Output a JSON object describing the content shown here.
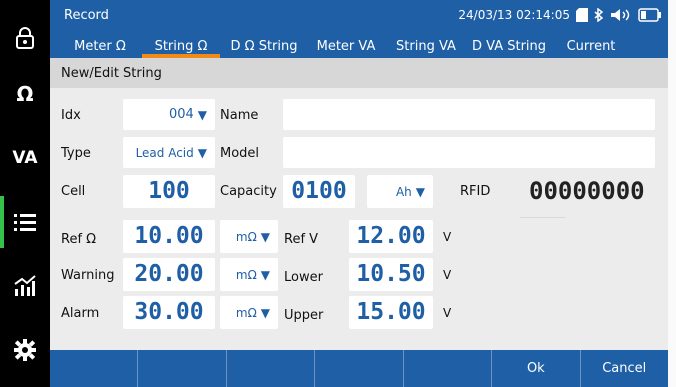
{
  "app": {
    "title": "Record",
    "datetime": "24/03/13 02:14:05"
  },
  "sidebar": {
    "items": [
      {
        "name": "lock-icon",
        "text": ""
      },
      {
        "name": "ohm-mode",
        "text": "Ω"
      },
      {
        "name": "va-mode",
        "text": "VA"
      },
      {
        "name": "list-icon",
        "text": ""
      },
      {
        "name": "chart-icon",
        "text": ""
      },
      {
        "name": "settings-icon",
        "text": ""
      }
    ]
  },
  "tabs": [
    {
      "label": "Meter Ω",
      "active": false
    },
    {
      "label": "String Ω",
      "active": true
    },
    {
      "label": "D Ω String",
      "active": false
    },
    {
      "label": "Meter VA",
      "active": false
    },
    {
      "label": "String VA",
      "active": false
    },
    {
      "label": "D VA String",
      "active": false
    },
    {
      "label": "Current",
      "active": false
    }
  ],
  "form": {
    "heading": "New/Edit String",
    "idx": {
      "label": "Idx",
      "value": "004"
    },
    "name": {
      "label": "Name",
      "value": ""
    },
    "type": {
      "label": "Type",
      "value": "Lead Acid"
    },
    "model": {
      "label": "Model",
      "value": ""
    },
    "cell": {
      "label": "Cell",
      "value": "100"
    },
    "capacity": {
      "label": "Capacity",
      "value": "0100",
      "unit": "Ah"
    },
    "rfid": {
      "label": "RFID",
      "value": "00000000"
    },
    "ref_ohm": {
      "label": "Ref Ω",
      "value": "10.00",
      "unit": "mΩ"
    },
    "warning": {
      "label": "Warning",
      "value": "20.00",
      "unit": "mΩ"
    },
    "alarm": {
      "label": "Alarm",
      "value": "30.00",
      "unit": "mΩ"
    },
    "ref_v": {
      "label": "Ref V",
      "value": "12.00",
      "unit": "V"
    },
    "lower": {
      "label": "Lower",
      "value": "10.50",
      "unit": "V"
    },
    "upper": {
      "label": "Upper",
      "value": "15.00",
      "unit": "V"
    }
  },
  "bottom": {
    "keys": [
      "",
      "",
      "",
      "",
      "",
      "Ok",
      "Cancel"
    ]
  },
  "colors": {
    "header_blue": "#1f5fa6",
    "accent_orange": "#f28a1a",
    "active_green": "#35c24a"
  }
}
